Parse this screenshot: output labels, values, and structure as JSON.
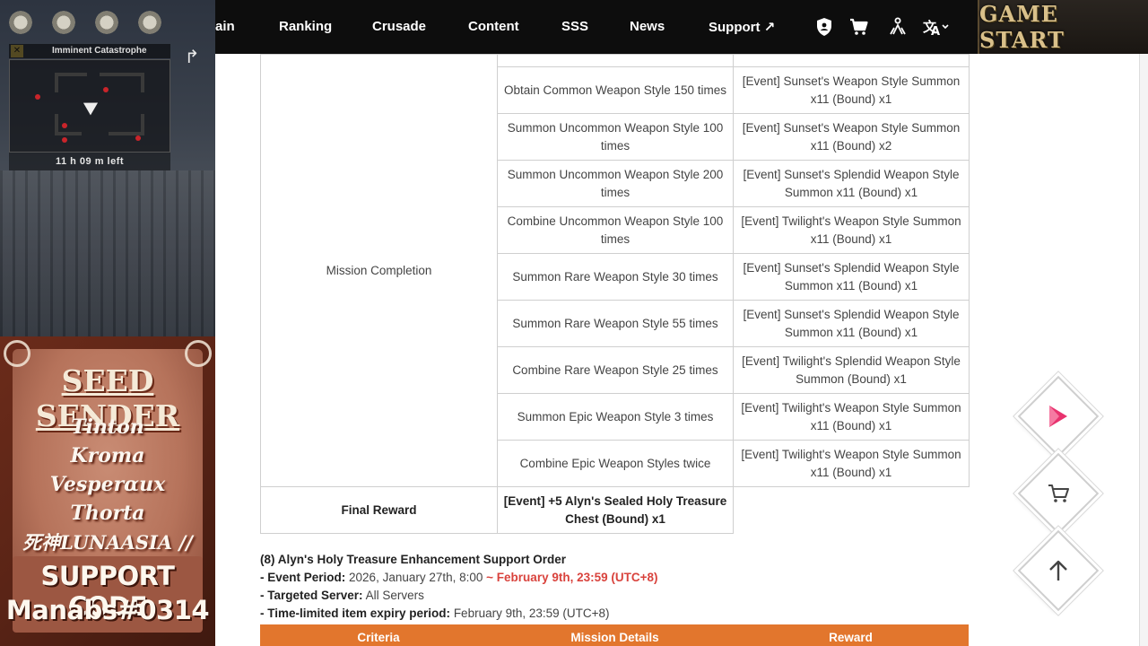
{
  "nav": {
    "items": [
      "ain",
      "Ranking",
      "Crusade",
      "Content",
      "SSS",
      "News",
      "Support ↗"
    ],
    "game_start": "GAME START"
  },
  "overlay": {
    "mission_title": "Imminent Catastrophe",
    "time_left": "11 h 09 m left",
    "sender_title": "SEED SENDER",
    "senders": [
      "Tinton",
      "Kroma",
      "Vesperαux",
      "Thorta",
      "死神LUNAASIA //"
    ],
    "support_code_label": "SUPPORT CODE",
    "support_code_value": "Manabs#0314"
  },
  "table": {
    "criteria": "Mission Completion",
    "rows": [
      {
        "details": "Obtain Common Weapon Style 150 times",
        "reward": "[Event] Sunset's Weapon Style Summon x11 (Bound) x1"
      },
      {
        "details": "Summon Uncommon Weapon Style 100 times",
        "reward": "[Event] Sunset's Weapon Style Summon x11 (Bound) x2"
      },
      {
        "details": "Summon Uncommon Weapon Style 200 times",
        "reward": "[Event] Sunset's Splendid Weapon Style Summon x11 (Bound) x1"
      },
      {
        "details": "Combine Uncommon Weapon Style 100 times",
        "reward": "[Event] Twilight's Weapon Style Summon x11 (Bound) x1"
      },
      {
        "details": "Summon Rare Weapon Style 30 times",
        "reward": "[Event] Sunset's Splendid Weapon Style Summon x11 (Bound) x1"
      },
      {
        "details": "Summon Rare Weapon Style 55 times",
        "reward": "[Event] Sunset's Splendid Weapon Style Summon x11 (Bound) x1"
      },
      {
        "details": "Combine Rare Weapon Style 25 times",
        "reward": "[Event] Twilight's Splendid Weapon Style Summon (Bound) x1"
      },
      {
        "details": "Summon Epic Weapon Style 3 times",
        "reward": "[Event] Twilight's Weapon Style Summon x11 (Bound) x1"
      },
      {
        "details": "Combine Epic Weapon Styles twice",
        "reward": "[Event] Twilight's Weapon Style Summon x11 (Bound) x1"
      }
    ],
    "final_label": "Final Reward",
    "final_reward": "[Event] +5 Alyn's Sealed Holy Treasure Chest (Bound) x1"
  },
  "section": {
    "heading": "(8) Alyn's Holy Treasure Enhancement Support Order",
    "period_label": "- Event Period:",
    "period_start": "2026, January 27th, 8:00",
    "period_end": "~ February 9th, 23:59 (UTC+8)",
    "server_label": "- Targeted Server:",
    "server_value": "All Servers",
    "expiry_label": "- Time-limited item expiry period:",
    "expiry_value": "February 9th, 23:59 (UTC+8)"
  },
  "table_header": {
    "criteria": "Criteria",
    "details": "Mission Details",
    "reward": "Reward"
  },
  "colors": {
    "nav_bg": "#0d0d0d",
    "accent_orange": "#e2762d",
    "red_text": "#d9433d",
    "brand_pink": "#e8326e"
  },
  "icons": [
    "shield-icon",
    "cart-icon",
    "people-icon",
    "translate-icon",
    "play-logo-icon",
    "cart-icon",
    "arrow-up-icon"
  ]
}
